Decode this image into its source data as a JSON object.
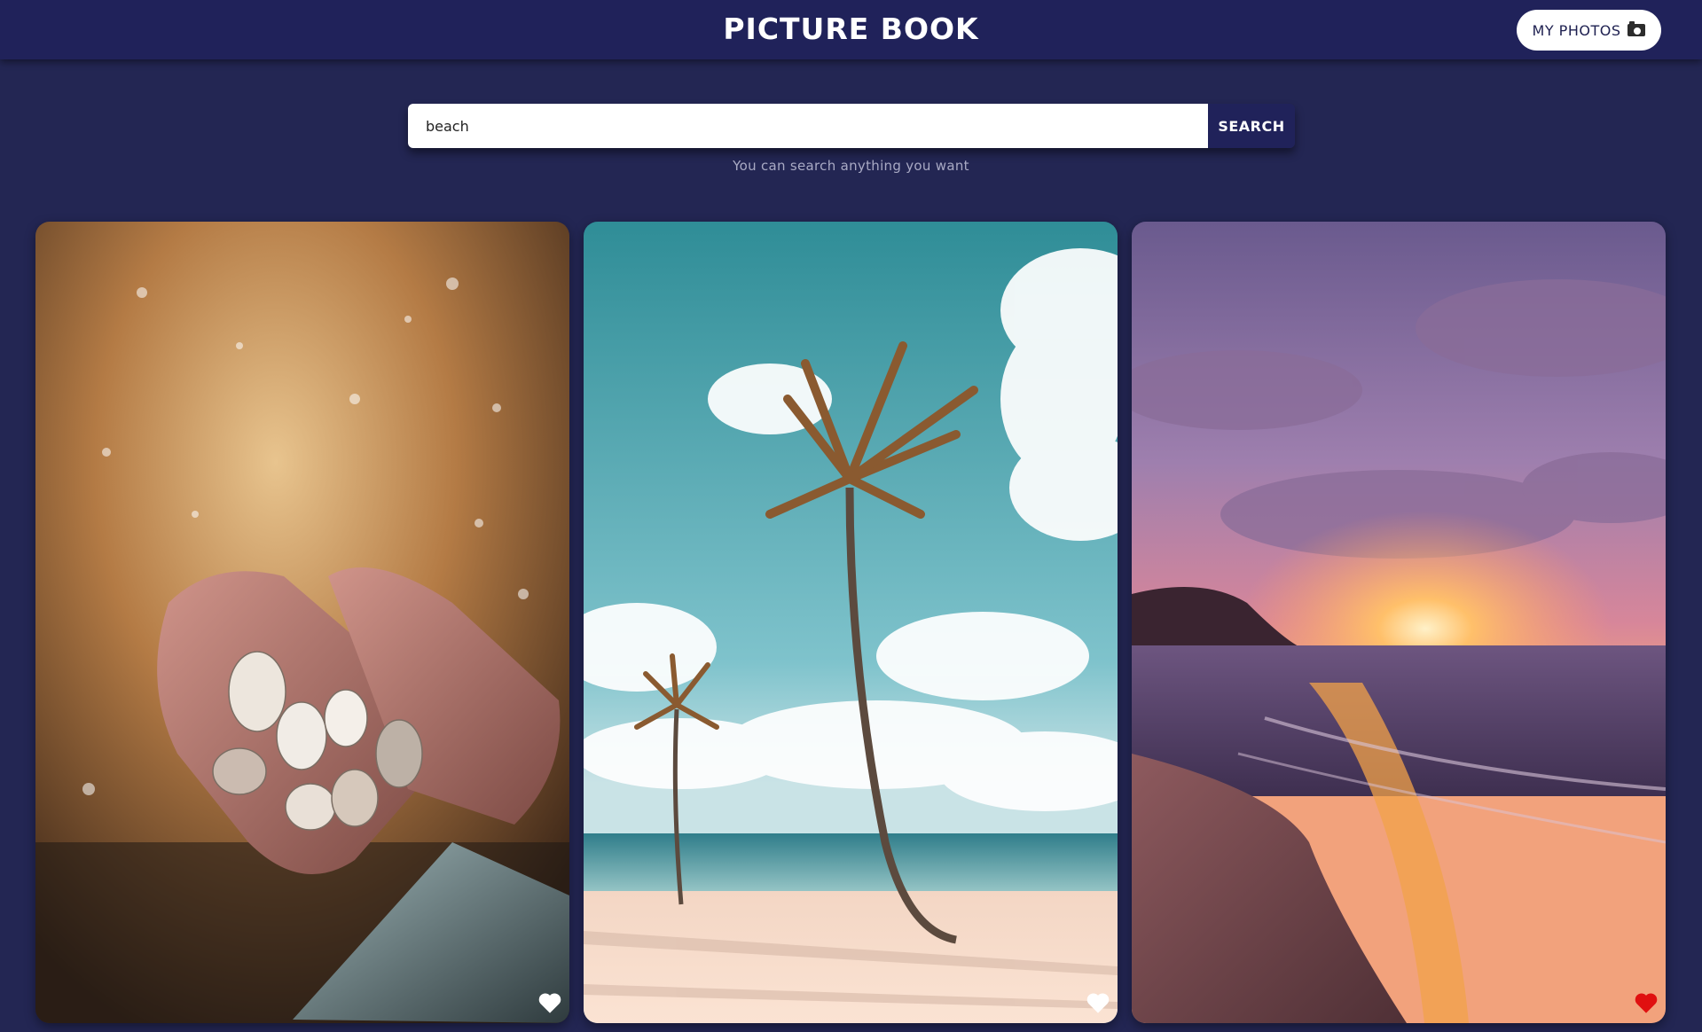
{
  "header": {
    "title": "PICTURE BOOK",
    "my_photos_label": "MY PHOTOS",
    "my_photos_icon": "camera-icon"
  },
  "search": {
    "value": "beach",
    "placeholder": "",
    "button_label": "SEARCH",
    "hint": "You can search anything you want"
  },
  "colors": {
    "background": "#232653",
    "header": "#20225a",
    "search_button": "#20225a",
    "liked_heart": "#e01010",
    "unliked_heart": "#ffffff"
  },
  "photos": [
    {
      "subject": "hands-holding-seashells",
      "liked": false,
      "heart_icon": "heart-icon"
    },
    {
      "subject": "palm-trees-on-beach",
      "liked": false,
      "heart_icon": "heart-icon"
    },
    {
      "subject": "beach-sunset",
      "liked": true,
      "heart_icon": "heart-icon"
    }
  ]
}
